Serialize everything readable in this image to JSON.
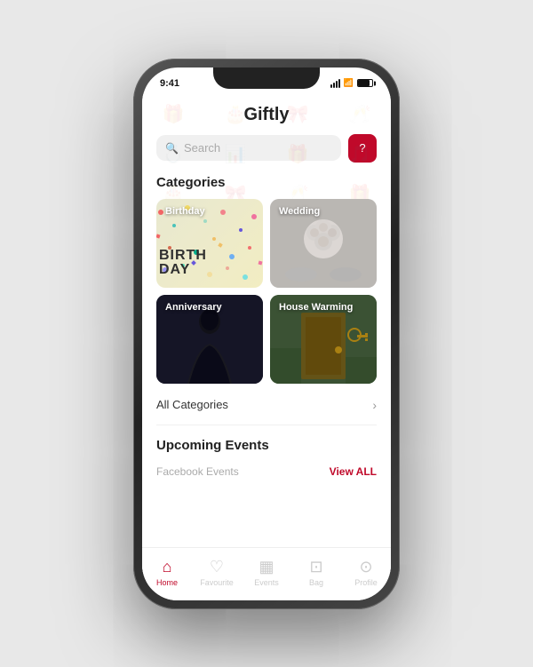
{
  "phone": {
    "status_bar": {
      "time": "9:41"
    }
  },
  "app": {
    "title": "Giftly",
    "search": {
      "placeholder": "Search",
      "icon": "🔍"
    },
    "search_btn_icon": "?",
    "sections": {
      "categories": {
        "label": "Categories",
        "items": [
          {
            "id": "birthday",
            "label": "Birthday"
          },
          {
            "id": "wedding",
            "label": "Wedding"
          },
          {
            "id": "anniversary",
            "label": "Anniversary"
          },
          {
            "id": "housewarming",
            "label": "House Warming"
          }
        ],
        "all_categories_label": "All Categories"
      },
      "upcoming": {
        "label": "Upcoming Events",
        "facebook_label": "Facebook Events",
        "view_all_label": "View ALL"
      }
    },
    "bottom_nav": [
      {
        "id": "home",
        "label": "Home",
        "icon": "🏠",
        "active": true
      },
      {
        "id": "favourite",
        "label": "Favourite",
        "icon": "♡",
        "active": false
      },
      {
        "id": "events",
        "label": "Events",
        "icon": "📅",
        "active": false
      },
      {
        "id": "bag",
        "label": "Bag",
        "icon": "🛍",
        "active": false
      },
      {
        "id": "profile",
        "label": "Profile",
        "icon": "👤",
        "active": false
      }
    ]
  },
  "colors": {
    "primary": "#c0092a",
    "active_nav": "#c0092a",
    "inactive": "#ccc"
  }
}
